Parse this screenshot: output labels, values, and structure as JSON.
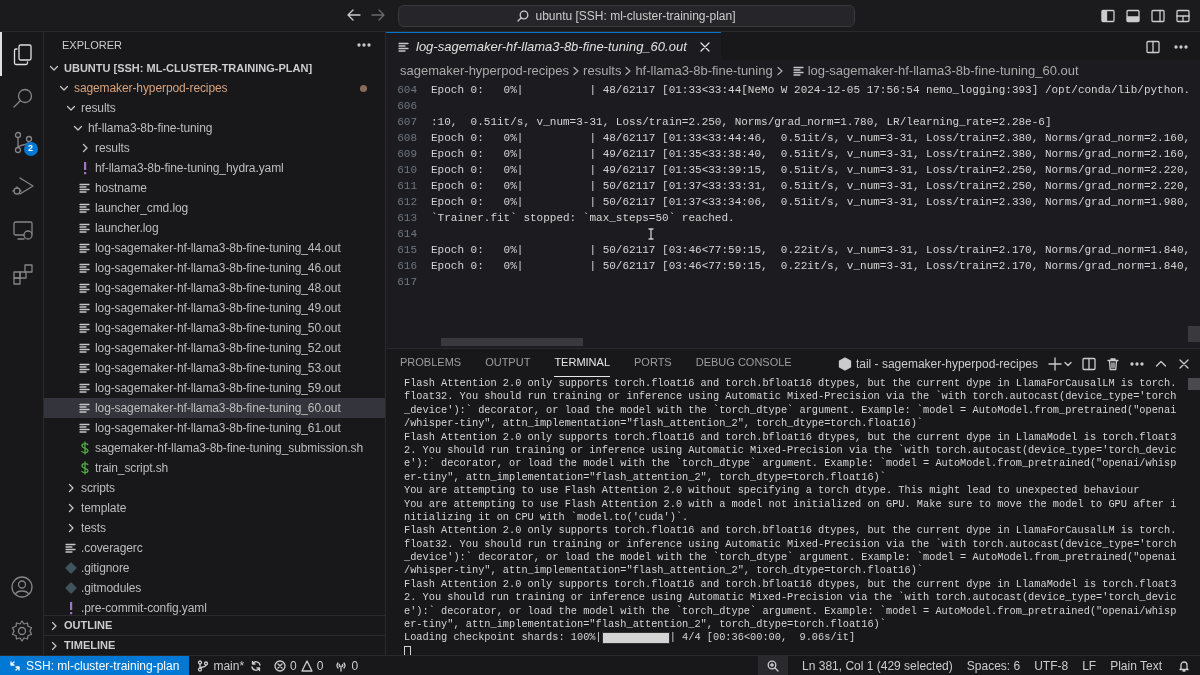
{
  "title_bar": {
    "search": "ubuntu [SSH: ml-cluster-training-plan]"
  },
  "activity_bar": {
    "items": [
      {
        "kind": "explorer",
        "selected": true
      },
      {
        "kind": "search",
        "selected": false
      },
      {
        "kind": "source_control",
        "selected": false,
        "badge": "2"
      },
      {
        "kind": "run",
        "selected": false
      },
      {
        "kind": "remote",
        "selected": false
      },
      {
        "kind": "extensions",
        "selected": false
      }
    ]
  },
  "sidebar": {
    "title": "EXPLORER",
    "sections": [
      {
        "label": "UBUNTU [SSH: ML-CLUSTER-TRAINING-PLAN]",
        "expanded": true,
        "tree": [
          {
            "label": "sagemaker-hyperpod-recipes",
            "kind": "folder",
            "expanded": true,
            "selected": false,
            "modified": true,
            "children": [
              {
                "label": "results",
                "kind": "folder",
                "expanded": true,
                "selected": false,
                "children": [
                  {
                    "label": "hf-llama3-8b-fine-tuning",
                    "kind": "folder",
                    "expanded": true,
                    "selected": false,
                    "children": [
                      {
                        "label": "results",
                        "kind": "folder",
                        "expanded": false,
                        "selected": false
                      },
                      {
                        "label": "hf-llama3-8b-fine-tuning_hydra.yaml",
                        "kind": "yaml",
                        "selected": false
                      },
                      {
                        "label": "hostname",
                        "kind": "text",
                        "selected": false
                      },
                      {
                        "label": "launcher_cmd.log",
                        "kind": "text",
                        "selected": false
                      },
                      {
                        "label": "launcher.log",
                        "kind": "text",
                        "selected": false
                      },
                      {
                        "label": "log-sagemaker-hf-llama3-8b-fine-tuning_44.out",
                        "kind": "text",
                        "selected": false
                      },
                      {
                        "label": "log-sagemaker-hf-llama3-8b-fine-tuning_46.out",
                        "kind": "text",
                        "selected": false
                      },
                      {
                        "label": "log-sagemaker-hf-llama3-8b-fine-tuning_48.out",
                        "kind": "text",
                        "selected": false
                      },
                      {
                        "label": "log-sagemaker-hf-llama3-8b-fine-tuning_49.out",
                        "kind": "text",
                        "selected": false
                      },
                      {
                        "label": "log-sagemaker-hf-llama3-8b-fine-tuning_50.out",
                        "kind": "text",
                        "selected": false
                      },
                      {
                        "label": "log-sagemaker-hf-llama3-8b-fine-tuning_52.out",
                        "kind": "text",
                        "selected": false
                      },
                      {
                        "label": "log-sagemaker-hf-llama3-8b-fine-tuning_53.out",
                        "kind": "text",
                        "selected": false
                      },
                      {
                        "label": "log-sagemaker-hf-llama3-8b-fine-tuning_59.out",
                        "kind": "text",
                        "selected": false
                      },
                      {
                        "label": "log-sagemaker-hf-llama3-8b-fine-tuning_60.out",
                        "kind": "text",
                        "selected": true
                      },
                      {
                        "label": "log-sagemaker-hf-llama3-8b-fine-tuning_61.out",
                        "kind": "text",
                        "selected": false
                      },
                      {
                        "label": "sagemaker-hf-llama3-8b-fine-tuning_submission.sh",
                        "kind": "shell",
                        "selected": false
                      },
                      {
                        "label": "train_script.sh",
                        "kind": "shell",
                        "selected": false
                      }
                    ]
                  }
                ]
              },
              {
                "label": "scripts",
                "kind": "folder",
                "expanded": false,
                "selected": false
              },
              {
                "label": "template",
                "kind": "folder",
                "expanded": false,
                "selected": false
              },
              {
                "label": "tests",
                "kind": "folder",
                "expanded": false,
                "selected": false
              },
              {
                "label": ".coveragerc",
                "kind": "text",
                "selected": false
              },
              {
                "label": ".gitignore",
                "kind": "git",
                "selected": false
              },
              {
                "label": ".gitmodules",
                "kind": "git",
                "selected": false
              },
              {
                "label": ".pre-commit-config.yaml",
                "kind": "yaml",
                "selected": false
              }
            ]
          }
        ]
      },
      {
        "label": "OUTLINE",
        "expanded": false
      },
      {
        "label": "TIMELINE",
        "expanded": false
      }
    ]
  },
  "editor": {
    "tab": {
      "label": "log-sagemaker-hf-llama3-8b-fine-tuning_60.out",
      "preview": true,
      "selected": true
    },
    "breadcrumbs": [
      "sagemaker-hyperpod-recipes",
      "results",
      "hf-llama3-8b-fine-tuning",
      "log-sagemaker-hf-llama3-8b-fine-tuning_60.out"
    ],
    "lines": [
      {
        "number": "604",
        "text": "Epoch 0:   0%|          | 48/62117 [01:33<33:44[NeMo W 2024-12-05 17:56:54 nemo_logging:393] /opt/conda/lib/python."
      },
      {
        "number": "606"
      },
      {
        "number": "607",
        "text": ":10,  0.51it/s, v_num=3-31, Loss/train=2.250, Norms/grad_norm=1.780, LR/learning_rate=2.28e-6]"
      },
      {
        "number": "608",
        "text": "Epoch 0:   0%|          | 48/62117 [01:33<33:44:46,  0.51it/s, v_num=3-31, Loss/train=2.380, Norms/grad_norm=2.160,"
      },
      {
        "number": "609",
        "text": "Epoch 0:   0%|          | 49/62117 [01:35<33:38:40,  0.51it/s, v_num=3-31, Loss/train=2.380, Norms/grad_norm=2.160,"
      },
      {
        "number": "610",
        "text": "Epoch 0:   0%|          | 49/62117 [01:35<33:39:15,  0.51it/s, v_num=3-31, Loss/train=2.250, Norms/grad_norm=2.220,"
      },
      {
        "number": "611",
        "text": "Epoch 0:   0%|          | 50/62117 [01:37<33:33:31,  0.51it/s, v_num=3-31, Loss/train=2.250, Norms/grad_norm=2.220,"
      },
      {
        "number": "612",
        "text": "Epoch 0:   0%|          | 50/62117 [01:37<33:34:06,  0.51it/s, v_num=3-31, Loss/train=2.330, Norms/grad_norm=1.980,"
      },
      {
        "number": "613",
        "text": "`Trainer.fit` stopped: `max_steps=50` reached."
      },
      {
        "number": "614"
      },
      {
        "number": "615",
        "text": "Epoch 0:   0%|          | 50/62117 [03:46<77:59:15,  0.22it/s, v_num=3-31, Loss/train=2.170, Norms/grad_norm=1.840,"
      },
      {
        "number": "616",
        "text": "Epoch 0:   0%|          | 50/62117 [03:46<77:59:15,  0.22it/s, v_num=3-31, Loss/train=2.170, Norms/grad_norm=1.840,"
      },
      {
        "number": "617"
      }
    ]
  },
  "panel": {
    "tabs": [
      {
        "label": "PROBLEMS",
        "selected": false
      },
      {
        "label": "OUTPUT",
        "selected": false
      },
      {
        "label": "TERMINAL",
        "selected": true
      },
      {
        "label": "PORTS",
        "selected": false
      },
      {
        "label": "DEBUG CONSOLE",
        "selected": false
      }
    ],
    "terminal_title": "tail - sagemaker-hyperpod-recipes",
    "lines": [
      {
        "kind": "text",
        "text": "Flash Attention 2.0 only supports torch.float16 and torch.bfloat16 dtypes, but the current dype in LlamaForCausalLM is torch."
      },
      {
        "kind": "text",
        "text": "float32. You should run training or inference using Automatic Mixed-Precision via the `with torch.autocast(device_type='torch"
      },
      {
        "kind": "text",
        "text": "_device'):` decorator, or load the model with the `torch_dtype` argument. Example: `model = AutoModel.from_pretrained(\"openai"
      },
      {
        "kind": "text",
        "text": "/whisper-tiny\", attn_implementation=\"flash_attention_2\", torch_dtype=torch.float16)`"
      },
      {
        "kind": "text",
        "text": "Flash Attention 2.0 only supports torch.float16 and torch.bfloat16 dtypes, but the current dype in LlamaModel is torch.float3"
      },
      {
        "kind": "text",
        "text": "2. You should run training or inference using Automatic Mixed-Precision via the `with torch.autocast(device_type='torch_devic"
      },
      {
        "kind": "text",
        "text": "e'):` decorator, or load the model with the `torch_dtype` argument. Example: `model = AutoModel.from_pretrained(\"openai/whisp"
      },
      {
        "kind": "text",
        "text": "er-tiny\", attn_implementation=\"flash_attention_2\", torch_dtype=torch.float16)`"
      },
      {
        "kind": "text",
        "text": "You are attempting to use Flash Attention 2.0 without specifying a torch dtype. This might lead to unexpected behaviour"
      },
      {
        "kind": "text",
        "text": "You are attempting to use Flash Attention 2.0 with a model not initialized on GPU. Make sure to move the model to GPU after i"
      },
      {
        "kind": "text",
        "text": "nitializing it on CPU with `model.to('cuda')`."
      },
      {
        "kind": "text",
        "text": "Flash Attention 2.0 only supports torch.float16 and torch.bfloat16 dtypes, but the current dype in LlamaForCausalLM is torch."
      },
      {
        "kind": "text",
        "text": "float32. You should run training or inference using Automatic Mixed-Precision via the `with torch.autocast(device_type='torch"
      },
      {
        "kind": "text",
        "text": "_device'):` decorator, or load the model with the `torch_dtype` argument. Example: `model = AutoModel.from_pretrained(\"openai"
      },
      {
        "kind": "text",
        "text": "/whisper-tiny\", attn_implementation=\"flash_attention_2\", torch_dtype=torch.float16)`"
      },
      {
        "kind": "text",
        "text": "Flash Attention 2.0 only supports torch.float16 and torch.bfloat16 dtypes, but the current dype in LlamaModel is torch.float3"
      },
      {
        "kind": "text",
        "text": "2. You should run training or inference using Automatic Mixed-Precision via the `with torch.autocast(device_type='torch_devic"
      },
      {
        "kind": "text",
        "text": "e'):` decorator, or load the model with the `torch_dtype` argument. Example: `model = AutoModel.from_pretrained(\"openai/whisp"
      },
      {
        "kind": "text",
        "text": "er-tiny\", attn_implementation=\"flash_attention_2\", torch_dtype=torch.float16)`"
      },
      {
        "kind": "progress",
        "prefix": "Loading checkpoint shards: 100%|",
        "level": 1,
        "suffix": "| 4/4 [00:36<00:00,  9.06s/it]"
      }
    ]
  },
  "status_bar": {
    "remote": "SSH: ml-cluster-training-plan",
    "branch": "main*",
    "errors": "0",
    "warnings": "0",
    "ports": "0",
    "position": "Ln 381, Col 1 (429 selected)",
    "indentation": "Spaces: 6",
    "encoding": "UTF-8",
    "eol": "LF",
    "language": "Plain Text"
  }
}
